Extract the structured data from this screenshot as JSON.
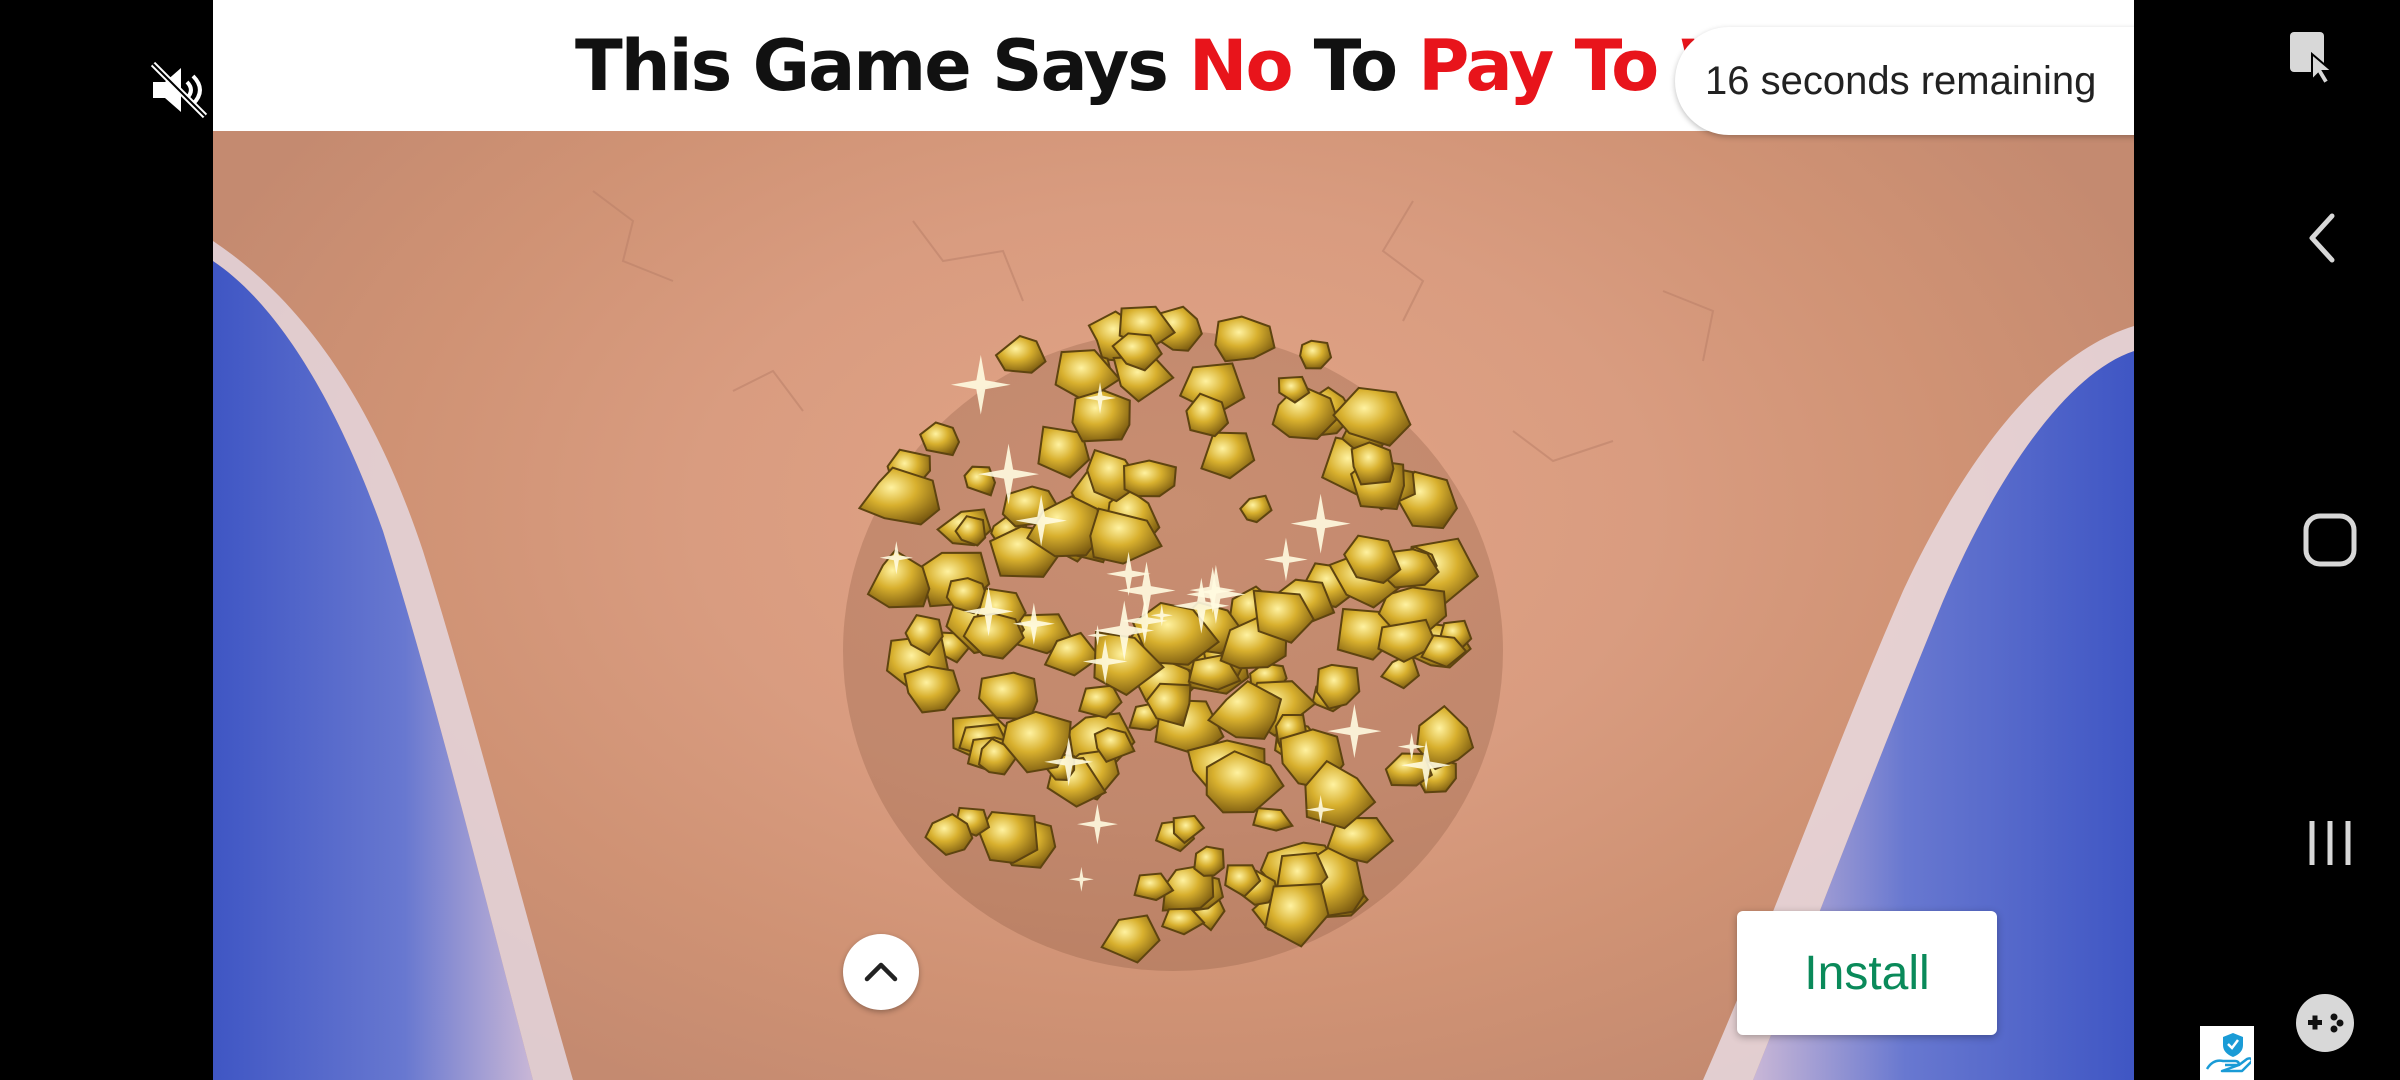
{
  "ad": {
    "headline_parts": [
      {
        "text": "This Game Says",
        "color": "#111111"
      },
      {
        "text": "No",
        "color": "#e8141b"
      },
      {
        "text": "To",
        "color": "#111111"
      },
      {
        "text": "Pay To W",
        "color": "#e8141b"
      }
    ],
    "install_label": "Install",
    "timer_text": "16 seconds remaining",
    "icons": {
      "mute": "volume-muted-icon",
      "close": "close-icon",
      "expand": "chevron-up-icon"
    }
  },
  "navbar": {
    "icons": [
      "screen-lock-cursor-icon",
      "back-icon",
      "home-icon",
      "recents-icon",
      "game-controller-icon"
    ],
    "badge_icon": "hand-shield-icon"
  },
  "colors": {
    "install_text": "#0a8a5a",
    "headline_red": "#e8141b",
    "sand": "#d99c80",
    "water": "#4a62c8"
  }
}
